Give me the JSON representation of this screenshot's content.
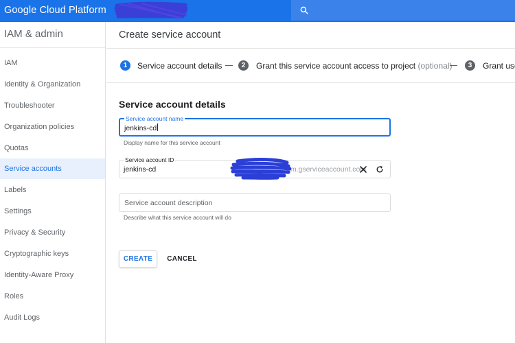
{
  "app": {
    "brand": "Google Cloud Platform",
    "brand_color": "#1a73e8",
    "search_icon": "search-icon"
  },
  "sidebar": {
    "title": "IAM & admin",
    "items": [
      {
        "label": "IAM",
        "active": false
      },
      {
        "label": "Identity & Organization",
        "active": false
      },
      {
        "label": "Troubleshooter",
        "active": false
      },
      {
        "label": "Organization policies",
        "active": false
      },
      {
        "label": "Quotas",
        "active": false
      },
      {
        "label": "Service accounts",
        "active": true
      },
      {
        "label": "Labels",
        "active": false
      },
      {
        "label": "Settings",
        "active": false
      },
      {
        "label": "Privacy & Security",
        "active": false
      },
      {
        "label": "Cryptographic keys",
        "active": false
      },
      {
        "label": "Identity-Aware Proxy",
        "active": false
      },
      {
        "label": "Roles",
        "active": false
      },
      {
        "label": "Audit Logs",
        "active": false
      }
    ]
  },
  "main": {
    "page_title": "Create service account",
    "steps": [
      {
        "number": "1",
        "label": "Service account details",
        "optional": ""
      },
      {
        "number": "2",
        "label": "Grant this service account access to project",
        "optional": "(optional)"
      },
      {
        "number": "3",
        "label": "Grant use",
        "optional": ""
      }
    ],
    "section_title": "Service account details",
    "form": {
      "name": {
        "label": "Service account name",
        "value": "jenkins-cd",
        "hint": "Display name for this service account"
      },
      "id": {
        "label": "Service account ID",
        "value": "jenkins-cd",
        "suffix": "am.gserviceaccount.com"
      },
      "description": {
        "placeholder": "Service account description",
        "hint": "Describe what this service account will do"
      }
    },
    "buttons": {
      "create": "CREATE",
      "cancel": "CANCEL"
    }
  },
  "colors": {
    "accent": "#1a73e8",
    "redaction": "#2b3fd6",
    "active_nav_bg": "#e8f0fe"
  }
}
